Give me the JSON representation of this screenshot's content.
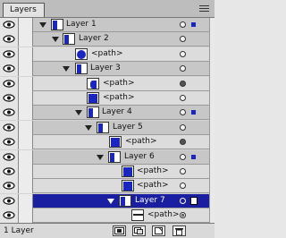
{
  "panel": {
    "tab_label": "Layers"
  },
  "rows": [
    {
      "kind": "layer",
      "label": "Layer 1",
      "expanded": true,
      "target": "single",
      "selection": "small"
    },
    {
      "kind": "layer",
      "label": "Layer 2",
      "expanded": true,
      "target": "single",
      "selection": "none"
    },
    {
      "kind": "path",
      "label": "<path>",
      "expanded": false,
      "target": "single",
      "selection": "none"
    },
    {
      "kind": "layer",
      "label": "Layer 3",
      "expanded": true,
      "target": "single",
      "selection": "none"
    },
    {
      "kind": "path",
      "label": "<path>",
      "expanded": false,
      "target": "filled",
      "selection": "none"
    },
    {
      "kind": "path",
      "label": "<path>",
      "expanded": false,
      "target": "single",
      "selection": "none"
    },
    {
      "kind": "layer",
      "label": "Layer 4",
      "expanded": true,
      "target": "single",
      "selection": "small"
    },
    {
      "kind": "layer",
      "label": "Layer 5",
      "expanded": true,
      "target": "single",
      "selection": "none"
    },
    {
      "kind": "path",
      "label": "<path>",
      "expanded": false,
      "target": "filled",
      "selection": "none"
    },
    {
      "kind": "layer",
      "label": "Layer 6",
      "expanded": true,
      "target": "single",
      "selection": "small"
    },
    {
      "kind": "path",
      "label": "<path>",
      "expanded": false,
      "target": "single",
      "selection": "none"
    },
    {
      "kind": "path",
      "label": "<path>",
      "expanded": false,
      "target": "single",
      "selection": "none"
    },
    {
      "kind": "layer",
      "label": "Layer 7",
      "expanded": true,
      "target": "single",
      "selection": "big",
      "selected": true
    },
    {
      "kind": "path",
      "label": "<path>",
      "expanded": false,
      "target": "double",
      "selection": "none"
    }
  ],
  "status": {
    "text": "1 Layer"
  },
  "colors": {
    "selection": "#1a1fa2",
    "artwork": "#1b25c0"
  },
  "icons": {
    "visibility": "eye-icon",
    "menu": "panel-menu-icon",
    "buttons": [
      "make-clipping-mask-icon",
      "new-sublayer-icon",
      "new-layer-icon",
      "trash-icon"
    ]
  }
}
